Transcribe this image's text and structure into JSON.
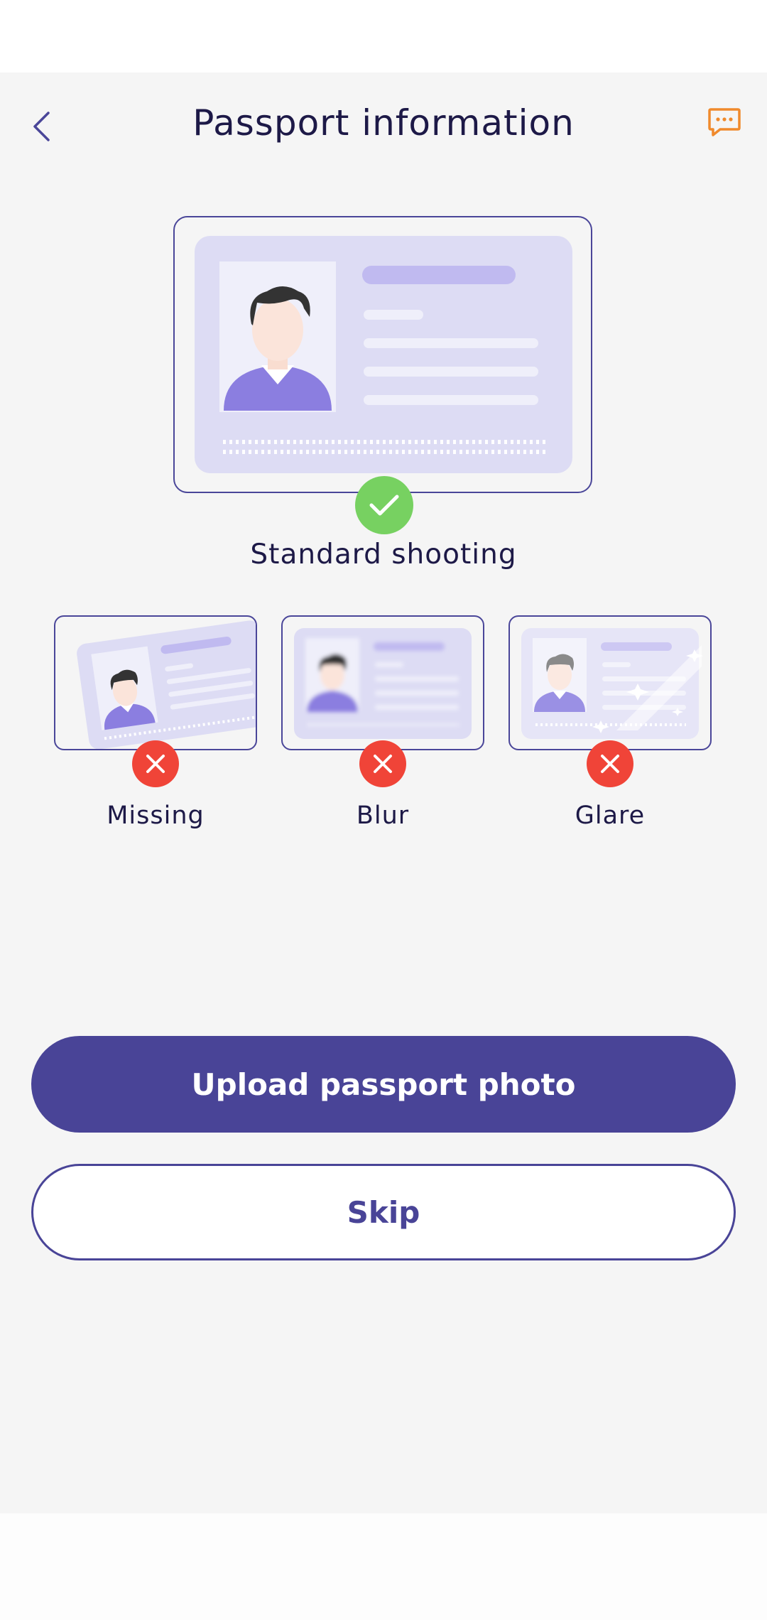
{
  "header": {
    "title": "Passport information",
    "back_icon": "chevron-left-icon",
    "chat_icon": "chat-bubble-icon"
  },
  "examples": {
    "standard": {
      "label": "Standard shooting",
      "status": "correct"
    },
    "bad": [
      {
        "label": "Missing",
        "status": "wrong"
      },
      {
        "label": "Blur",
        "status": "wrong"
      },
      {
        "label": "Glare",
        "status": "wrong"
      }
    ]
  },
  "actions": {
    "upload_label": "Upload passport photo",
    "skip_label": "Skip"
  },
  "colors": {
    "primary": "#494497",
    "success": "#77d161",
    "error": "#f04438",
    "chat_accent": "#f08a2c",
    "title_text": "#1d1947",
    "background": "#f5f5f5"
  }
}
